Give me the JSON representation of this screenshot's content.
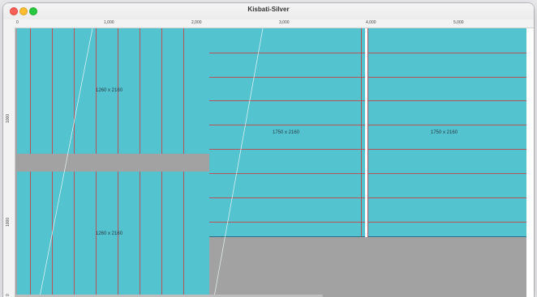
{
  "window": {
    "title": "Kisbati-Silver"
  },
  "ruler": {
    "top_ticks": [
      "0",
      "1,000",
      "2,000",
      "3,000",
      "4,000",
      "5,000"
    ],
    "left_ticks": [
      "1000",
      "1000",
      "0"
    ]
  },
  "panels": {
    "top_left_label": "1260 x 2160",
    "bottom_left_label": "1260 x 2160",
    "middle_label": "1750 x 2160",
    "right_label": "1750 x 2160"
  },
  "colors": {
    "panel_fill": "#53c3cf",
    "seam_lines": "#b8535c",
    "background": "#a2a2a2"
  }
}
